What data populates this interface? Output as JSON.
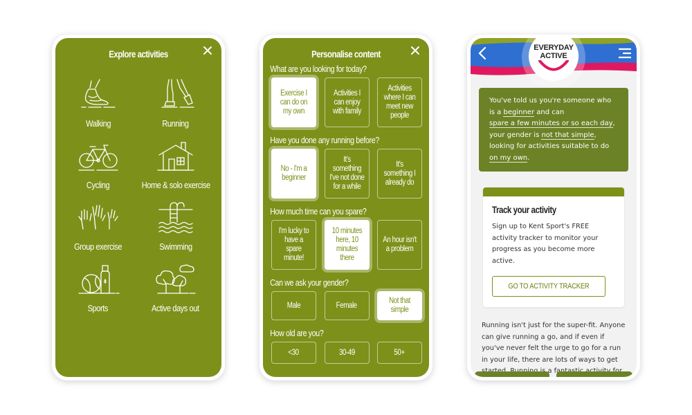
{
  "explore": {
    "title": "Explore activities",
    "close_icon": "close-icon",
    "activities": [
      {
        "label": "Walking",
        "icon": "walking-shoe-icon"
      },
      {
        "label": "Running",
        "icon": "running-legs-icon"
      },
      {
        "label": "Cycling",
        "icon": "bicycle-icon"
      },
      {
        "label": "Home & solo exercise",
        "icon": "house-icon"
      },
      {
        "label": "Group exercise",
        "icon": "raised-hands-icon"
      },
      {
        "label": "Swimming",
        "icon": "swimming-pool-icon"
      },
      {
        "label": "Sports",
        "icon": "ball-bottle-icon"
      },
      {
        "label": "Active days out",
        "icon": "trees-icon"
      }
    ]
  },
  "personalise": {
    "title": "Personalise content",
    "close_icon": "close-icon",
    "questions": [
      {
        "label": "What are you looking for today?",
        "options": [
          "Exercise I can do on my own",
          "Activities I can enjoy with family",
          "Activities where I can meet new people"
        ],
        "selected": 0
      },
      {
        "label": "Have you done any running before?",
        "options": [
          "No - I'm a beginner",
          "It's something I've not done for a while",
          "It's something I already do"
        ],
        "selected": 0
      },
      {
        "label": "How much time can you spare?",
        "options": [
          "I'm lucky to have a spare minute!",
          "10 minutes here, 10 minutes there",
          "An hour isn't a problem"
        ],
        "selected": 1
      },
      {
        "label": "Can we ask your gender?",
        "options": [
          "Male",
          "Female",
          "Not that simple"
        ],
        "selected": 2
      },
      {
        "label": "How old are you?",
        "options": [
          "<30",
          "30-49",
          "50+"
        ],
        "selected": null
      }
    ]
  },
  "everyday": {
    "logo_line1": "EVERYDAY",
    "logo_line2": "ACTIVE",
    "back_icon": "chevron-left-icon",
    "menu_icon": "hamburger-menu-icon",
    "colors": {
      "blue": "#2f6fd1",
      "pink": "#e0185f",
      "green": "#8fa224",
      "summary_bg": "#6b8227"
    },
    "summary": {
      "p1": "You've told us you're someone who is a ",
      "l1": "beginner",
      "p2": " and can ",
      "l2": "spare a few minutes or so each day",
      "p3": ", your gender is ",
      "l3": "not that simple",
      "p4": ", looking for activities suitable to do ",
      "l4": "on my own",
      "p5": "."
    },
    "card": {
      "title": "Track your activity",
      "text": "Sign up to Kent Sport's FREE activity tracker to monitor your progress as you become more active.",
      "button": "GO TO ACTIVITY TRACKER"
    },
    "body": "Running isn't just for the super-fit. Anyone can give running a go, and if even if you've never felt the urge to go for a run in your life, there are lots of ways to get started. Running is a fantastic activity for building your general fitness and losing weight, and"
  }
}
